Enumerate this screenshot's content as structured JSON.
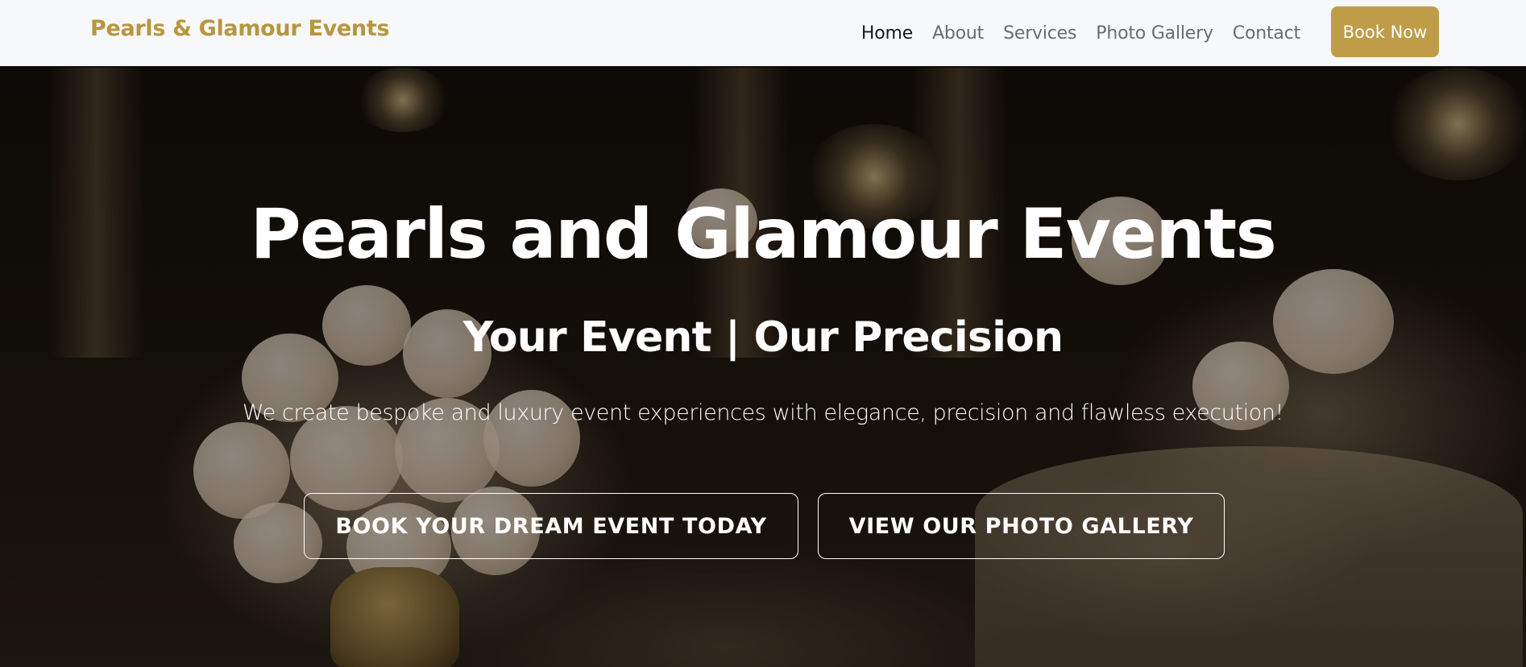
{
  "navbar": {
    "brand": "Pearls & Glamour Events",
    "links": [
      {
        "label": "Home",
        "active": true
      },
      {
        "label": "About",
        "active": false
      },
      {
        "label": "Services",
        "active": false
      },
      {
        "label": "Photo Gallery",
        "active": false
      },
      {
        "label": "Contact",
        "active": false
      }
    ],
    "book_now_label": "Book Now"
  },
  "hero": {
    "title": "Pearls and Glamour Events",
    "subtitle": "Your Event | Our Precision",
    "description": "We create bespoke and luxury event experiences with elegance, precision and flawless execution!",
    "cta_primary": "BOOK YOUR DREAM EVENT TODAY",
    "cta_secondary": "VIEW OUR PHOTO GALLERY"
  },
  "colors": {
    "brand_gold": "#b8963e",
    "button_gold": "#bf9c47",
    "nav_background": "#f7f8fa",
    "nav_text": "#6b6b6b",
    "nav_active_text": "#1a1a1a",
    "hero_text": "#ffffff"
  }
}
